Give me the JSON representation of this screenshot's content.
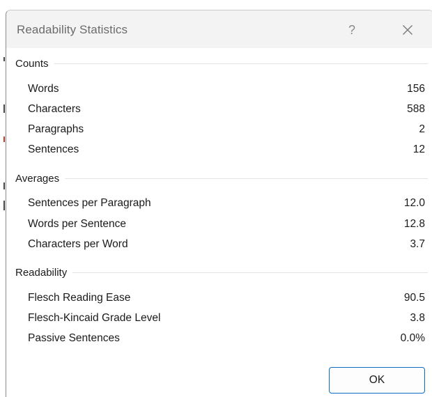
{
  "dialog": {
    "title": "Readability Statistics",
    "help_glyph": "?",
    "close_icon": "close-icon",
    "ok_label": "OK",
    "accent_color": "#0a6cc2"
  },
  "groups": {
    "counts": {
      "label": "Counts",
      "rows": [
        {
          "label": "Words",
          "value": "156"
        },
        {
          "label": "Characters",
          "value": "588"
        },
        {
          "label": "Paragraphs",
          "value": "2"
        },
        {
          "label": "Sentences",
          "value": "12"
        }
      ]
    },
    "averages": {
      "label": "Averages",
      "rows": [
        {
          "label": "Sentences per Paragraph",
          "value": "12.0"
        },
        {
          "label": "Words per Sentence",
          "value": "12.8"
        },
        {
          "label": "Characters per Word",
          "value": "3.7"
        }
      ]
    },
    "readability": {
      "label": "Readability",
      "rows": [
        {
          "label": "Flesch Reading Ease",
          "value": "90.5"
        },
        {
          "label": "Flesch-Kincaid Grade Level",
          "value": "3.8"
        },
        {
          "label": "Passive Sentences",
          "value": "0.0%"
        }
      ]
    }
  }
}
